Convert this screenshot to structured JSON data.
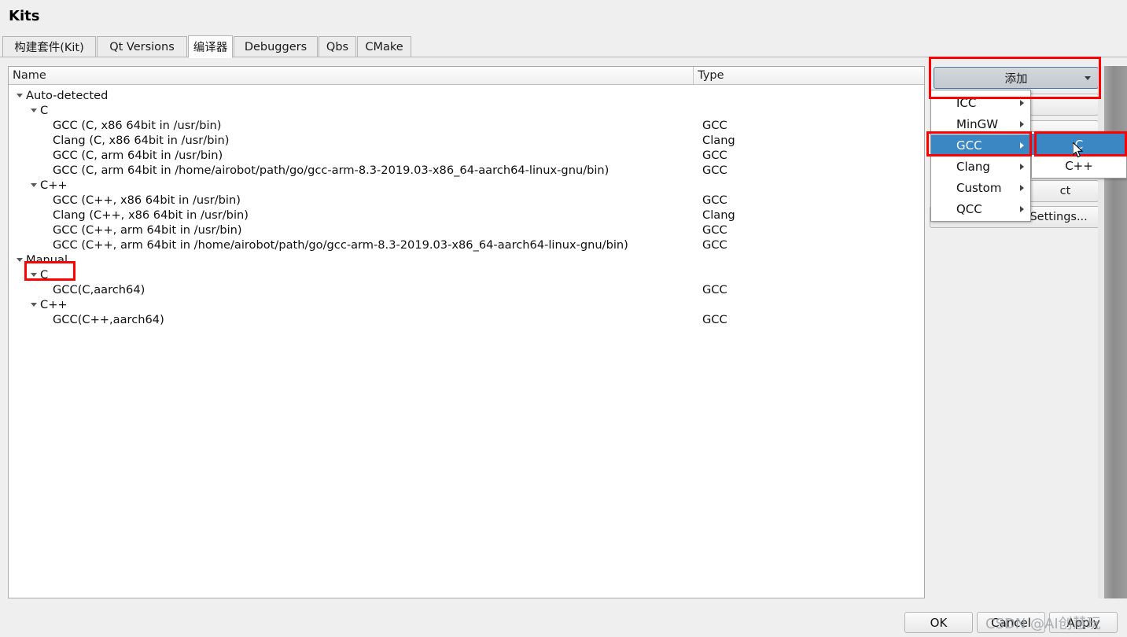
{
  "window": {
    "title": "Kits"
  },
  "tabs": [
    {
      "label": "构建套件(Kit)",
      "selected": false
    },
    {
      "label": "Qt Versions",
      "selected": false
    },
    {
      "label": "编译器",
      "selected": true
    },
    {
      "label": "Debuggers",
      "selected": false
    },
    {
      "label": "Qbs",
      "selected": false
    },
    {
      "label": "CMake",
      "selected": false
    }
  ],
  "table": {
    "columns": [
      "Name",
      "Type"
    ],
    "rows": [
      {
        "name": "Auto-detected",
        "type": "",
        "depth": 0,
        "expandable": true
      },
      {
        "name": "C",
        "type": "",
        "depth": 1,
        "expandable": true
      },
      {
        "name": "GCC (C, x86 64bit in /usr/bin)",
        "type": "GCC",
        "depth": 2,
        "expandable": false
      },
      {
        "name": "Clang (C, x86 64bit in /usr/bin)",
        "type": "Clang",
        "depth": 2,
        "expandable": false
      },
      {
        "name": "GCC (C, arm 64bit in /usr/bin)",
        "type": "GCC",
        "depth": 2,
        "expandable": false
      },
      {
        "name": "GCC (C, arm 64bit in /home/airobot/path/go/gcc-arm-8.3-2019.03-x86_64-aarch64-linux-gnu/bin)",
        "type": "GCC",
        "depth": 2,
        "expandable": false
      },
      {
        "name": "C++",
        "type": "",
        "depth": 1,
        "expandable": true
      },
      {
        "name": "GCC (C++, x86 64bit in /usr/bin)",
        "type": "GCC",
        "depth": 2,
        "expandable": false
      },
      {
        "name": "Clang (C++, x86 64bit in /usr/bin)",
        "type": "Clang",
        "depth": 2,
        "expandable": false
      },
      {
        "name": "GCC (C++, arm 64bit in /usr/bin)",
        "type": "GCC",
        "depth": 2,
        "expandable": false
      },
      {
        "name": "GCC (C++, arm 64bit in /home/airobot/path/go/gcc-arm-8.3-2019.03-x86_64-aarch64-linux-gnu/bin)",
        "type": "GCC",
        "depth": 2,
        "expandable": false
      },
      {
        "name": "Manual",
        "type": "",
        "depth": 0,
        "expandable": true
      },
      {
        "name": "C",
        "type": "",
        "depth": 1,
        "expandable": true
      },
      {
        "name": "GCC(C,aarch64)",
        "type": "GCC",
        "depth": 2,
        "expandable": false
      },
      {
        "name": "C++",
        "type": "",
        "depth": 1,
        "expandable": true
      },
      {
        "name": "GCC(C++,aarch64)",
        "type": "GCC",
        "depth": 2,
        "expandable": false
      }
    ]
  },
  "side_buttons": {
    "add": "添加",
    "clone": "",
    "remove": "",
    "redetect": "ct",
    "auto_detection_settings": "Auto-detection Settings..."
  },
  "add_menu": {
    "items": [
      {
        "label": "ICC",
        "has_submenu": true,
        "highlight": false
      },
      {
        "label": "MinGW",
        "has_submenu": true,
        "highlight": false
      },
      {
        "label": "GCC",
        "has_submenu": true,
        "highlight": true
      },
      {
        "label": "Clang",
        "has_submenu": true,
        "highlight": false
      },
      {
        "label": "Custom",
        "has_submenu": true,
        "highlight": false
      },
      {
        "label": "QCC",
        "has_submenu": true,
        "highlight": false
      }
    ],
    "submenu": {
      "items": [
        {
          "label": "C",
          "highlight": true
        },
        {
          "label": "C++",
          "highlight": false
        }
      ]
    }
  },
  "footer": {
    "ok": "OK",
    "cancel": "Cancel",
    "apply": "Apply"
  },
  "watermark": {
    "text": "CSDN @AI创慧玩"
  },
  "colors": {
    "highlight": "#3a87c4",
    "annotation": "#ff0000",
    "window_bg": "#efefef",
    "panel_bg": "#ffffff"
  }
}
